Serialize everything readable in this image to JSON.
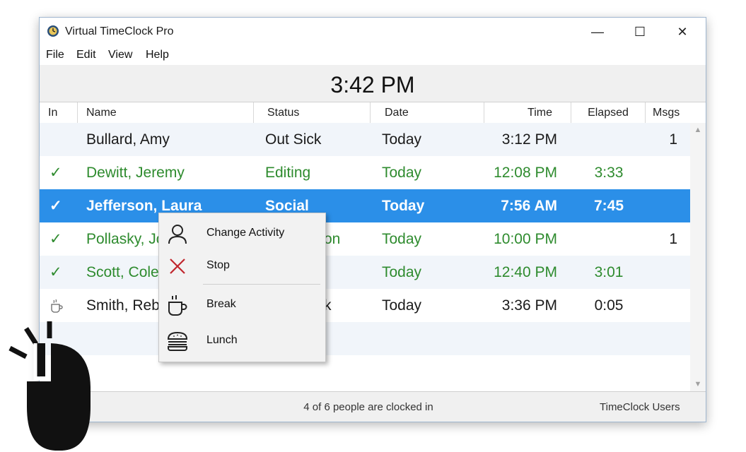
{
  "window": {
    "title": "Virtual TimeClock Pro",
    "controls": {
      "minimize": "—",
      "maximize": "☐",
      "close": "✕"
    }
  },
  "menu": [
    "File",
    "Edit",
    "View",
    "Help"
  ],
  "clock": "3:42 PM",
  "columns": {
    "in": "In",
    "name": "Name",
    "status": "Status",
    "date": "Date",
    "time": "Time",
    "elapsed": "Elapsed",
    "msgs": "Msgs"
  },
  "rows": [
    {
      "in": "",
      "name": "Bullard, Amy",
      "status": "Out Sick",
      "date": "Today",
      "time": "3:12 PM",
      "elapsed": "",
      "msgs": "1"
    },
    {
      "in": "✓",
      "name": "Dewitt, Jeremy",
      "status": "Editing",
      "date": "Today",
      "time": "12:08 PM",
      "elapsed": "3:33",
      "msgs": ""
    },
    {
      "in": "✓",
      "name": "Jefferson, Laura",
      "status": "Social",
      "date": "Today",
      "time": "7:56 AM",
      "elapsed": "7:45",
      "msgs": ""
    },
    {
      "in": "✓",
      "name": "Pollasky, Jo",
      "status": "on",
      "date": "Today",
      "time": "10:00 PM",
      "elapsed": "",
      "msgs": "1"
    },
    {
      "in": "✓",
      "name": "Scott, Cole",
      "status": "",
      "date": "Today",
      "time": "12:40 PM",
      "elapsed": "3:01",
      "msgs": ""
    },
    {
      "in": "coffee-icon",
      "name": "Smith, Reb",
      "status": "k",
      "date": "Today",
      "time": "3:36 PM",
      "elapsed": "0:05",
      "msgs": ""
    }
  ],
  "context_menu": {
    "items": [
      {
        "label": "Change Activity",
        "icon": "person-icon"
      },
      {
        "label": "Stop",
        "icon": "red-x-icon"
      },
      {
        "label": "Break",
        "icon": "coffee-cup-icon"
      },
      {
        "label": "Lunch",
        "icon": "burger-icon"
      }
    ]
  },
  "status_bar": {
    "summary": "4 of 6 people are clocked in",
    "right": "TimeClock Users"
  },
  "colors": {
    "selected_row": "#2b8fe8",
    "clocked_in_text": "#2e8b2e",
    "stop_red": "#c0262d"
  }
}
